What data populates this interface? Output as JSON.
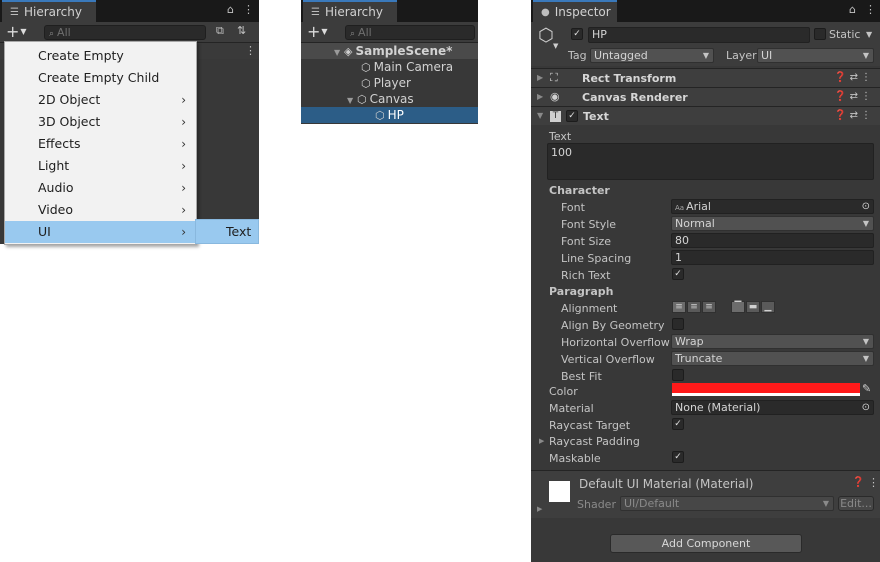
{
  "hierarchy_left": {
    "tab_label": "Hierarchy",
    "search_placeholder": "All",
    "menu_items": [
      {
        "label": "Create Empty",
        "has_submenu": false
      },
      {
        "label": "Create Empty Child",
        "has_submenu": false
      },
      {
        "label": "2D Object",
        "has_submenu": true
      },
      {
        "label": "3D Object",
        "has_submenu": true
      },
      {
        "label": "Effects",
        "has_submenu": true
      },
      {
        "label": "Light",
        "has_submenu": true
      },
      {
        "label": "Audio",
        "has_submenu": true
      },
      {
        "label": "Video",
        "has_submenu": true
      },
      {
        "label": "UI",
        "has_submenu": true
      }
    ],
    "selected_menu_item": "UI",
    "submenu_item": "Text"
  },
  "hierarchy_right": {
    "tab_label": "Hierarchy",
    "search_placeholder": "All",
    "tree": [
      {
        "label": "SampleScene*",
        "kind": "scene"
      },
      {
        "label": "Main Camera",
        "kind": "object"
      },
      {
        "label": "Player",
        "kind": "object"
      },
      {
        "label": "Canvas",
        "kind": "object"
      },
      {
        "label": "HP",
        "kind": "selected"
      }
    ]
  },
  "inspector": {
    "tab_label": "Inspector",
    "object_name": "HP",
    "static_label": "Static",
    "tag_label": "Tag",
    "tag_value": "Untagged",
    "layer_label": "Layer",
    "layer_value": "UI",
    "components": {
      "rect_transform": "Rect Transform",
      "canvas_renderer": "Canvas Renderer",
      "text": "Text"
    },
    "text_label": "Text",
    "text_value": "100",
    "character_header": "Character",
    "font_label": "Font",
    "font_icon": "Aa",
    "font_value": "Arial",
    "font_style_label": "Font Style",
    "font_style_value": "Normal",
    "font_size_label": "Font Size",
    "font_size_value": "80",
    "line_spacing_label": "Line Spacing",
    "line_spacing_value": "1",
    "rich_text_label": "Rich Text",
    "paragraph_header": "Paragraph",
    "alignment_label": "Alignment",
    "align_by_geometry_label": "Align By Geometry",
    "h_overflow_label": "Horizontal Overflow",
    "h_overflow_value": "Wrap",
    "v_overflow_label": "Vertical Overflow",
    "v_overflow_value": "Truncate",
    "best_fit_label": "Best Fit",
    "color_label": "Color",
    "color_value": "#ff1a1a",
    "material_label": "Material",
    "material_value": "None (Material)",
    "raycast_target_label": "Raycast Target",
    "raycast_padding_label": "Raycast Padding",
    "maskable_label": "Maskable",
    "material_asset_name": "Default UI Material (Material)",
    "shader_label": "Shader",
    "shader_value": "UI/Default",
    "edit_label": "Edit...",
    "add_component_label": "Add Component"
  },
  "colors": {
    "panel_bg": "#383838",
    "tab_accent": "#3a79bb",
    "menu_highlight": "#99c9ef",
    "tree_selection": "#2c5d87"
  },
  "icons": [
    "list-icon",
    "lock-icon",
    "kebab-icon",
    "plus-icon",
    "search-icon",
    "scene-icon",
    "gameobject-icon",
    "info-icon",
    "help-icon",
    "settings-icon",
    "eye-icon",
    "text-component-icon",
    "rect-transform-icon",
    "eyedropper-icon",
    "object-picker-icon"
  ]
}
